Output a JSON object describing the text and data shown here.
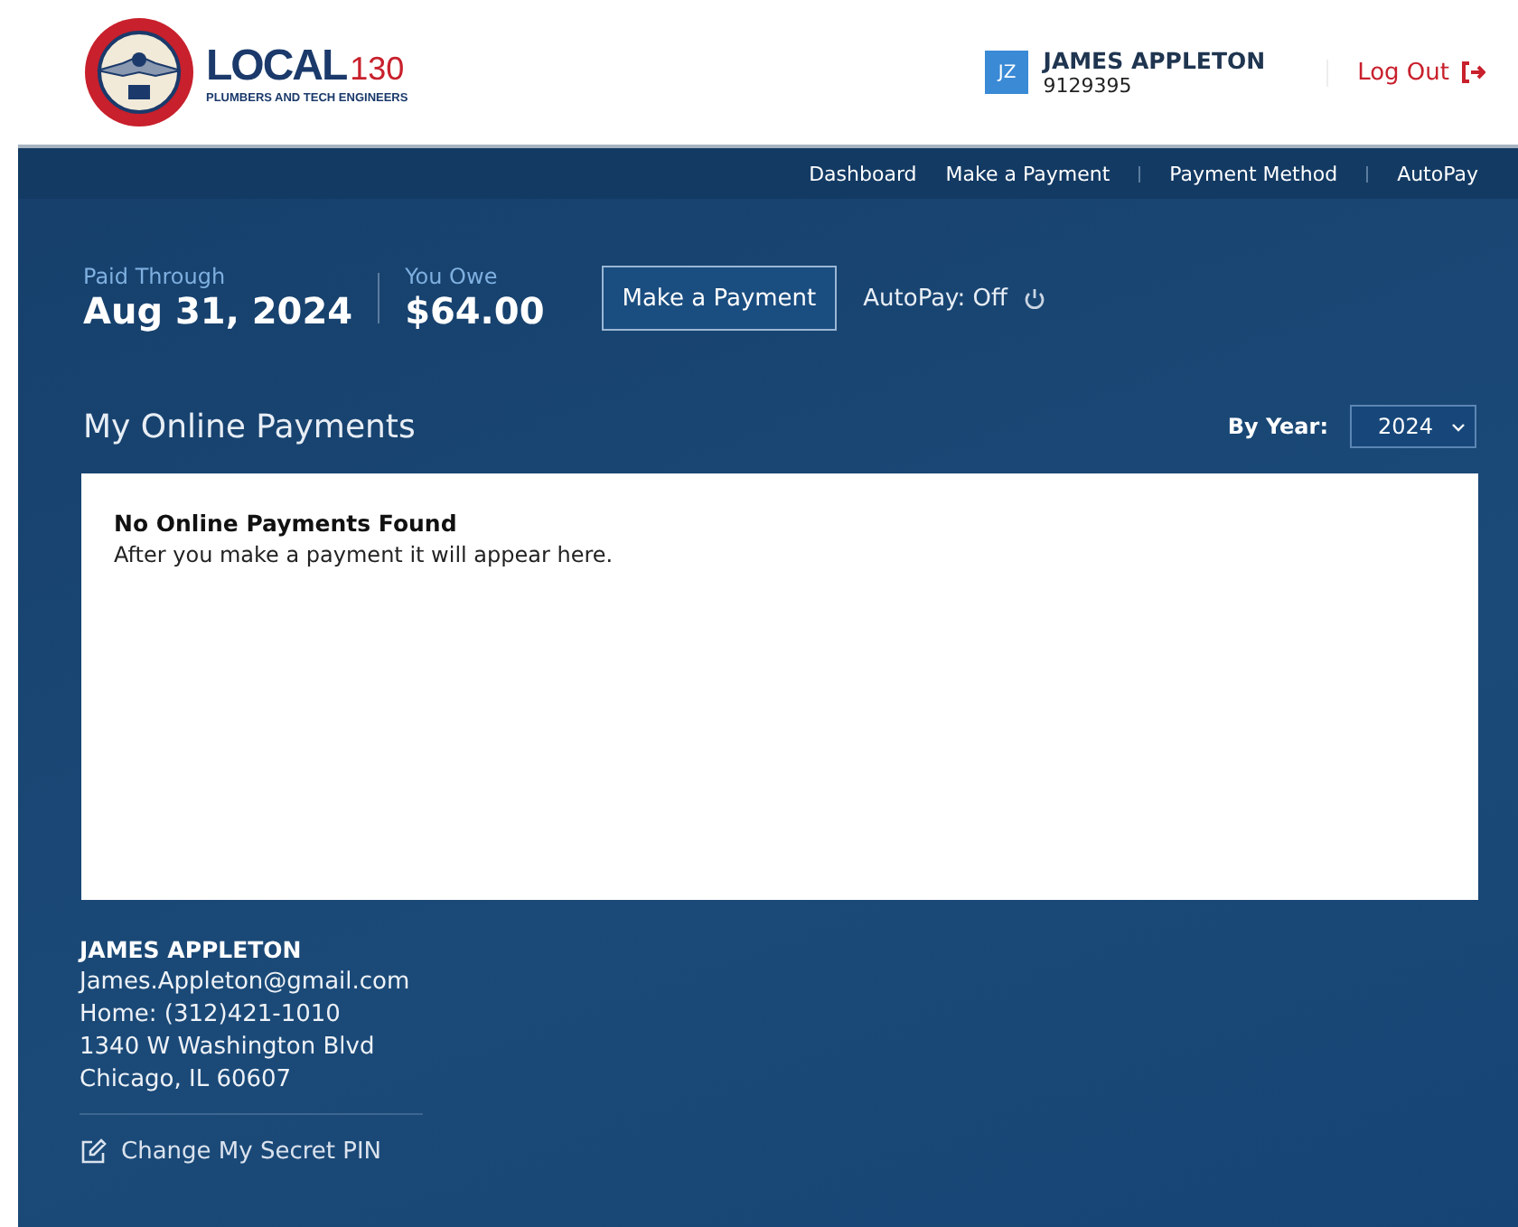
{
  "header": {
    "logo": {
      "name": "LOCAL",
      "number": "130",
      "tagline": "PLUMBERS AND TECH ENGINEERS"
    },
    "user": {
      "initials": "JZ",
      "name": "JAMES APPLETON",
      "member_id": "9129395"
    },
    "logout": "Log Out"
  },
  "nav": [
    {
      "label": "Dashboard"
    },
    {
      "label": "Make a Payment"
    },
    {
      "label": "Payment Method"
    },
    {
      "label": "AutoPay"
    }
  ],
  "summary": {
    "paid_label": "Paid Through",
    "paid_value": "Aug 31, 2024",
    "owe_label": "You Owe",
    "owe_value": "$64.00",
    "pay_button": "Make a Payment",
    "autopay": "AutoPay: Off"
  },
  "payments": {
    "title": "My Online Payments",
    "year_label": "By Year:",
    "year": "2024",
    "empty_title": "No Online Payments Found",
    "empty_text": "After you make a payment it will appear here."
  },
  "contact": {
    "name": "JAMES APPLETON",
    "lines": [
      "James.Appleton@gmail.com",
      "Home: (312)421-1010",
      "1340 W Washington Blvd",
      "Chicago, IL 60607"
    ],
    "pin_link": "Change My Secret PIN"
  }
}
